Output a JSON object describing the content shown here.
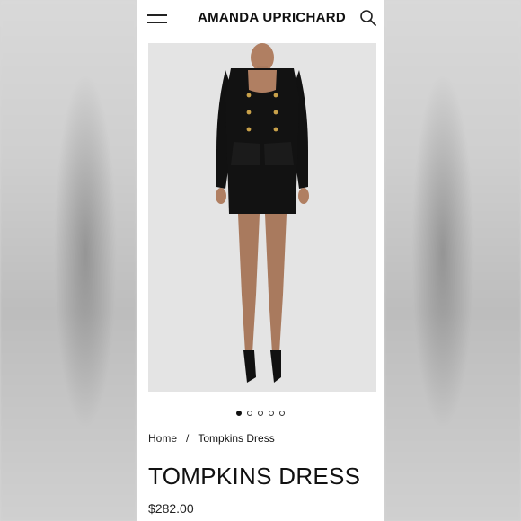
{
  "header": {
    "brand": "AMANDA UPRICHARD",
    "menu_icon": "hamburger-menu-icon",
    "search_icon": "search-icon"
  },
  "gallery": {
    "image_alt": "Model wearing black double-breasted mini dress",
    "slide_count": 5,
    "active_index": 0
  },
  "breadcrumb": {
    "home": "Home",
    "separator": "/",
    "current": "Tompkins Dress"
  },
  "product": {
    "title": "TOMPKINS DRESS",
    "price": "$282.00"
  },
  "colors": {
    "accent": "#111111",
    "background": "#ffffff"
  }
}
